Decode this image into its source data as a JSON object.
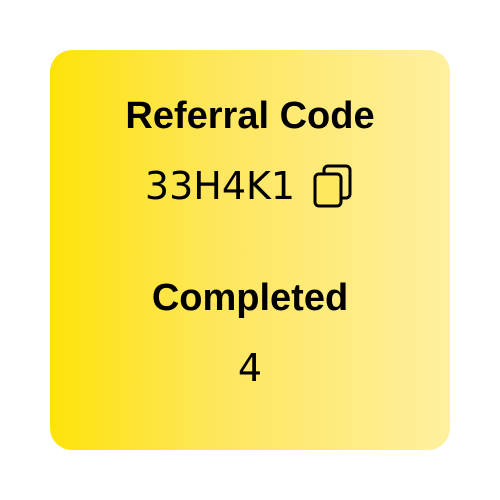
{
  "referral": {
    "heading": "Referral Code",
    "code": "33H4K1",
    "copy_icon": "copy-icon"
  },
  "completed": {
    "heading": "Completed",
    "count": "4"
  },
  "colors": {
    "gradient_start": "#fde30a",
    "gradient_end": "#fff09f",
    "text": "#000000"
  }
}
